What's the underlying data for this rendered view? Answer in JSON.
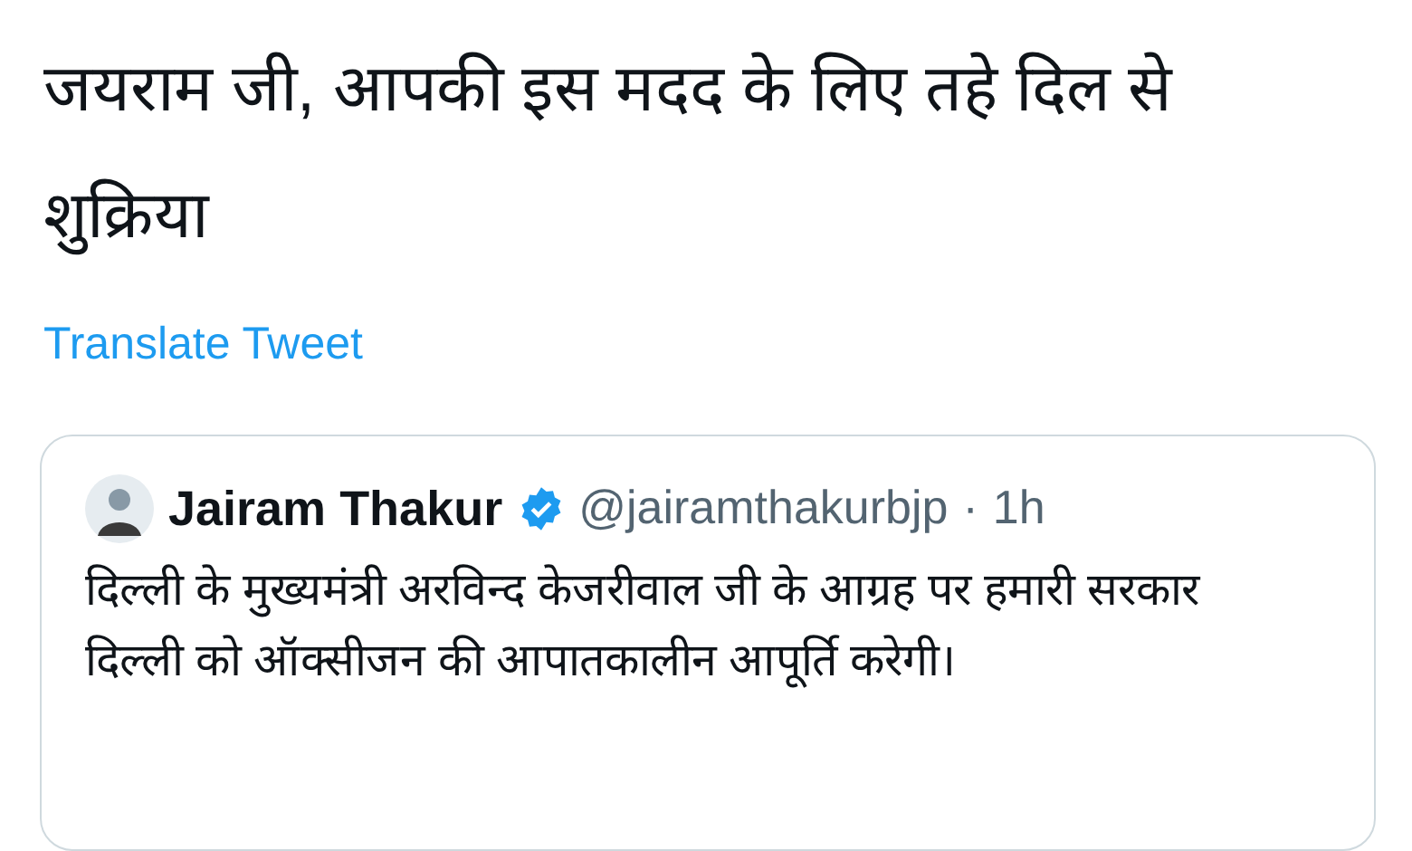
{
  "tweet": {
    "text": "जयराम जी, आपकी इस मदद के लिए तहे दिल से शुक्रिया",
    "translate_link": "Translate Tweet"
  },
  "quoted_tweet": {
    "name": "Jairam Thakur",
    "verified": true,
    "handle": "@jairamthakurbjp",
    "separator": "·",
    "time": "1h",
    "text": "दिल्ली के मुख्यमंत्री अरविन्द केजरीवाल जी के आग्रह पर हमारी सरकार दिल्ली को ऑक्सीजन की आपातकालीन आपूर्ति करेगी।"
  }
}
